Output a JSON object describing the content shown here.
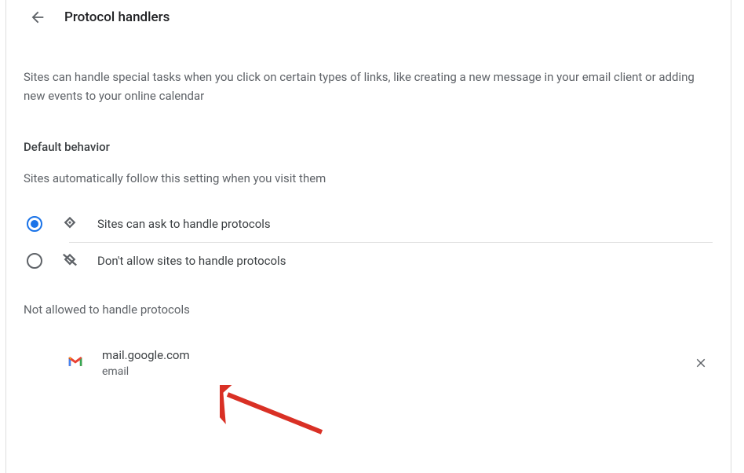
{
  "header": {
    "title": "Protocol handlers"
  },
  "description": "Sites can handle special tasks when you click on certain types of links, like creating a new message in your email client or adding new events to your online calendar",
  "default_behavior": {
    "title": "Default behavior",
    "subtitle": "Sites automatically follow this setting when you visit them",
    "options": [
      {
        "label": "Sites can ask to handle protocols",
        "selected": true
      },
      {
        "label": "Don't allow sites to handle protocols",
        "selected": false
      }
    ]
  },
  "blocked": {
    "title": "Not allowed to handle protocols",
    "sites": [
      {
        "domain": "mail.google.com",
        "type": "email"
      }
    ]
  }
}
